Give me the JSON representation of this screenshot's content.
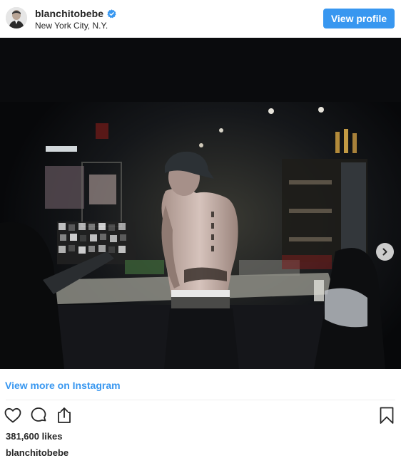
{
  "header": {
    "username": "blanchitobebe",
    "verified": true,
    "location": "New York City, N.Y.",
    "view_profile_label": "View profile",
    "avatar_icon": "profile-avatar"
  },
  "post": {
    "image_icon": "tattoo-shop-photo",
    "carousel_next_icon": "chevron-right-icon"
  },
  "view_more_label": "View more on Instagram",
  "actions": {
    "like_icon": "heart-icon",
    "comment_icon": "comment-icon",
    "share_icon": "share-icon",
    "save_icon": "bookmark-icon"
  },
  "likes_text": "381,600 likes",
  "caption_username": "blanchitobebe",
  "colors": {
    "accent": "#3897f0",
    "text": "#262626",
    "divider": "#efefef"
  }
}
